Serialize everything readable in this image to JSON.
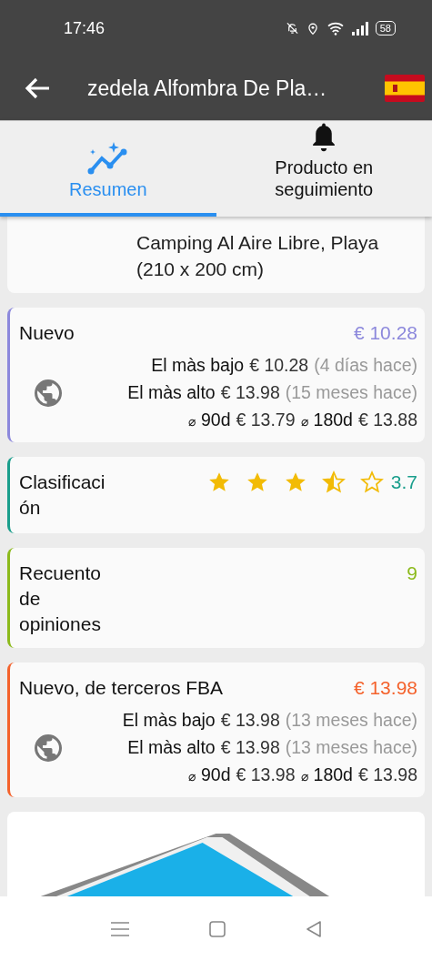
{
  "status_bar": {
    "time": "17:46",
    "battery": "58"
  },
  "app_bar": {
    "title": "zedela Alfombra De Pla…"
  },
  "tabs": [
    {
      "label": "Resumen",
      "selected": true,
      "kind": "chart"
    },
    {
      "label": "Producto en seguimiento",
      "selected": false,
      "kind": "bell"
    }
  ],
  "product": {
    "title_lines": [
      "Camping Al Aire Libre, Playa",
      "(210 x 200 cm)"
    ]
  },
  "cards": [
    {
      "kind": "price",
      "label": "Nuevo",
      "value": "€ 10.28",
      "color": "#8c88dc",
      "stats": [
        {
          "label": "El màs bajo",
          "price": "€ 10.28",
          "ago": "(4 días hace)"
        },
        {
          "label": "El màs alto",
          "price": "€ 13.98",
          "ago": "(15 meses hace)"
        }
      ],
      "averages": [
        {
          "label": "⌀",
          "period": "90d",
          "price": "€ 13.79"
        },
        {
          "label": "⌀",
          "period": "180d",
          "price": "€ 13.88"
        }
      ]
    },
    {
      "kind": "rating",
      "label": "Clasificaci ón",
      "value": "3.7",
      "color": "#1a9e8c",
      "stars": 3.5
    },
    {
      "kind": "count",
      "label": "Recuento de opiniones",
      "value": "9",
      "color": "#8cba1c"
    },
    {
      "kind": "price",
      "label": "Nuevo, de terceros FBA",
      "value": "€ 13.98",
      "color": "#f4622c",
      "stats": [
        {
          "label": "El màs bajo",
          "price": "€ 13.98",
          "ago": "(13 meses hace)"
        },
        {
          "label": "El màs alto",
          "price": "€ 13.98",
          "ago": "(13 meses hace)"
        }
      ],
      "averages": [
        {
          "label": "⌀",
          "period": "90d",
          "price": "€ 13.98"
        },
        {
          "label": "⌀",
          "period": "180d",
          "price": "€ 13.98"
        }
      ]
    },
    {
      "kind": "picture"
    }
  ]
}
